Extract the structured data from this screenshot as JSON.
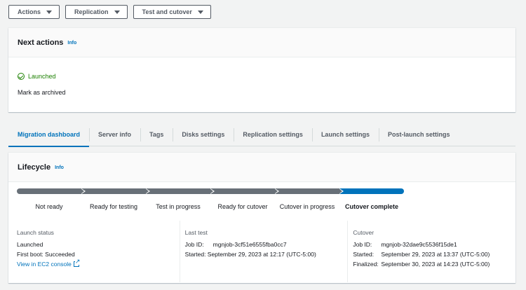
{
  "toolbar": {
    "actions": "Actions",
    "replication": "Replication",
    "test_cutover": "Test and cutover"
  },
  "next_actions": {
    "title": "Next actions",
    "info": "Info",
    "status": "Launched",
    "archive": "Mark as archived"
  },
  "tabs": [
    {
      "label": "Migration dashboard",
      "active": true
    },
    {
      "label": "Server info"
    },
    {
      "label": "Tags"
    },
    {
      "label": "Disks settings"
    },
    {
      "label": "Replication settings"
    },
    {
      "label": "Launch settings"
    },
    {
      "label": "Post-launch settings"
    }
  ],
  "lifecycle": {
    "title": "Lifecycle",
    "info": "Info",
    "steps": [
      "Not ready",
      "Ready for testing",
      "Test in progress",
      "Ready for cutover",
      "Cutover in progress",
      "Cutover complete"
    ],
    "current_step": "Cutover complete",
    "launch_status": {
      "title": "Launch status",
      "value": "Launched",
      "first_boot": "First boot: Succeeded",
      "console_link": "View in EC2 console"
    },
    "last_test": {
      "title": "Last test",
      "job_label": "Job ID:",
      "job_id": "mgnjob-3cf51e6555fba0cc7",
      "started": "Started: September 29, 2023 at 12:17 (UTC-5:00)"
    },
    "cutover": {
      "title": "Cutover",
      "job_label": "Job ID:",
      "job_id": "mgnjob-32dae9c5536f15de1",
      "started_label": "Started:",
      "started": "September 29, 2023 at 13:37 (UTC-5:00)",
      "finalized_label": "Finalized:",
      "finalized": "September 30, 2023 at 14:23 (UTC-5:00)"
    }
  },
  "colors": {
    "accent": "#0073bb",
    "success": "#1d8102",
    "progress_done": "#687078"
  }
}
